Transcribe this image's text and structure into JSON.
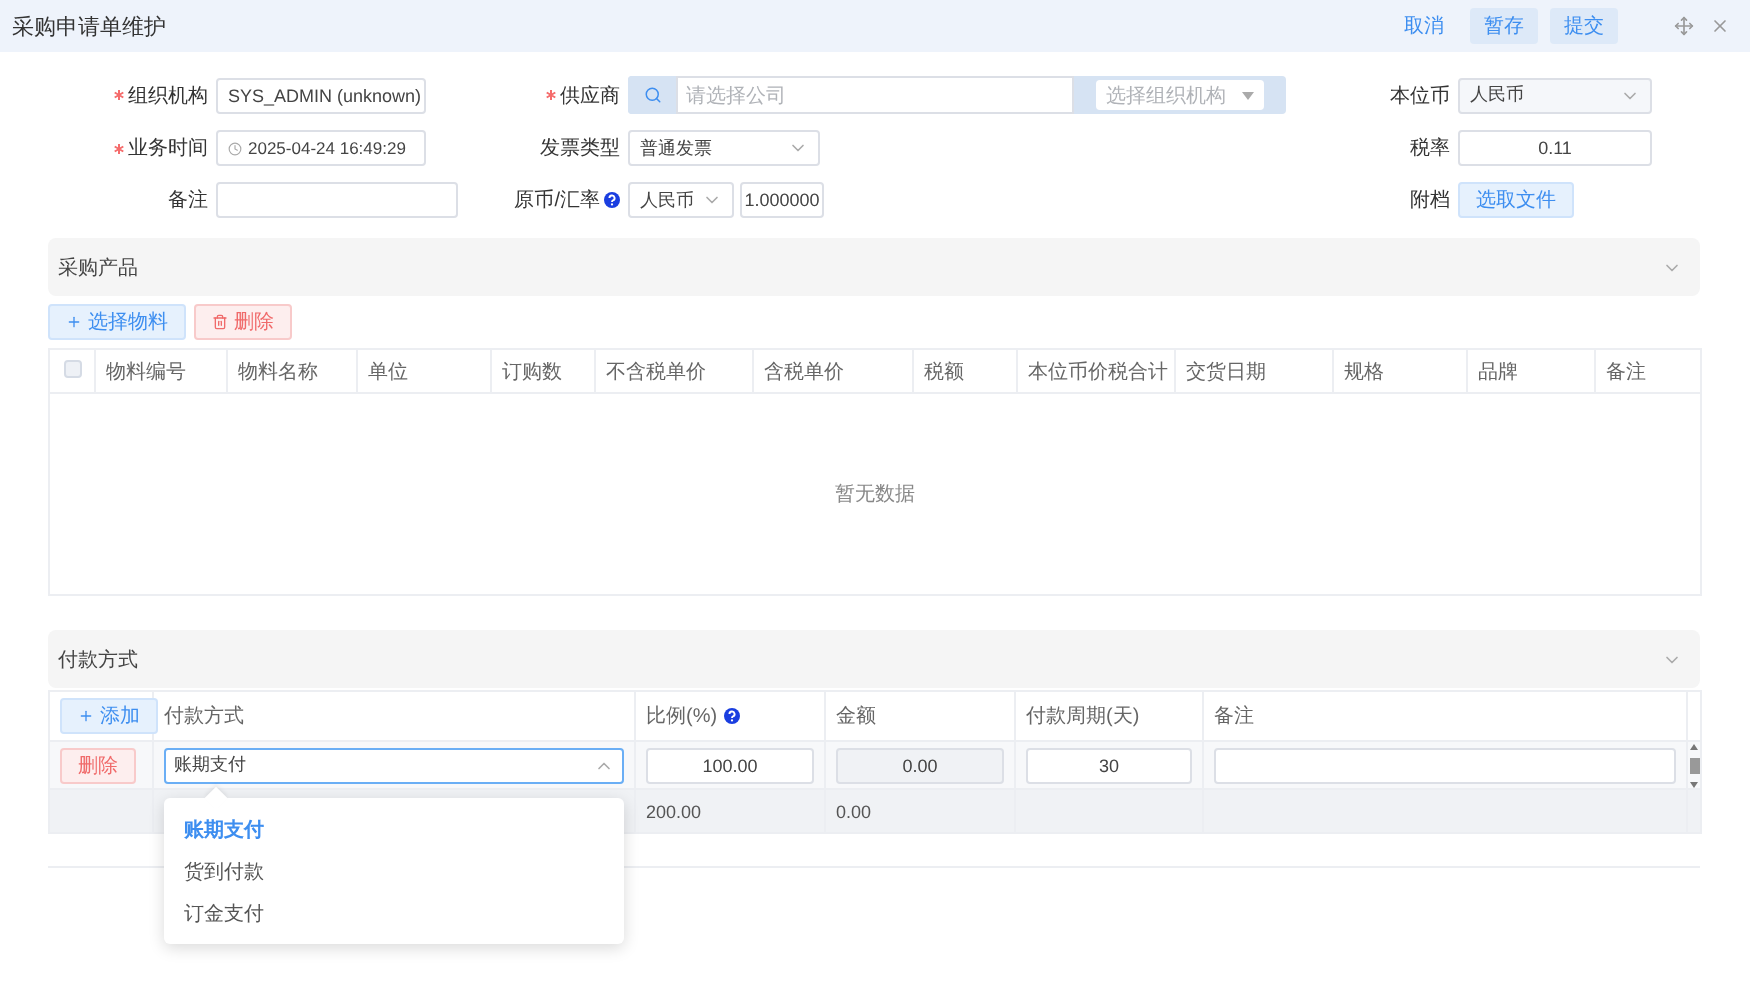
{
  "header": {
    "title": "采购申请单维护",
    "actions": [
      {
        "label": "取消",
        "kind": "link"
      },
      {
        "label": "暂存",
        "kind": "button"
      },
      {
        "label": "提交",
        "kind": "button"
      }
    ]
  },
  "form": {
    "fields": [
      {
        "label": "组织机构",
        "required": true,
        "kind": "select",
        "value": "SYS_ADMIN (unknown)"
      },
      {
        "label": "供应商",
        "required": true,
        "kind": "supplier",
        "placeholder": "请选择公司",
        "org_placeholder": "选择组织机构"
      },
      {
        "label": "本位币",
        "required": false,
        "kind": "select_light",
        "value": "人民币"
      },
      {
        "label": "业务时间",
        "required": true,
        "kind": "date",
        "value": "2025-04-24 16:49:29"
      },
      {
        "label": "发票类型",
        "required": false,
        "kind": "select_light",
        "value": "普通发票"
      },
      {
        "label": "税率",
        "required": false,
        "kind": "number",
        "value": "0.11"
      },
      {
        "label": "备注",
        "required": false,
        "kind": "text"
      },
      {
        "label": "原币/汇率",
        "required": false,
        "kind": "currency_rate",
        "help": true,
        "currency": "人民币",
        "rate": "1.000000"
      },
      {
        "label": "附档",
        "required": false,
        "kind": "upload",
        "button_label": "选取文件"
      }
    ]
  },
  "products": {
    "title": "采购产品",
    "expanded": true,
    "toolbar": [
      {
        "label": "选择物料",
        "kind": "add"
      },
      {
        "label": "删除",
        "kind": "delete"
      }
    ],
    "select_all_checked": false,
    "columns": [
      "物料编号",
      "物料名称",
      "单位",
      "订购数",
      "不含税单价",
      "含税单价",
      "税额",
      "本位币价税合计",
      "交货日期",
      "规格",
      "品牌",
      "备注"
    ],
    "empty_text": "暂无数据"
  },
  "payment": {
    "title": "付款方式",
    "expanded": true,
    "add_label": "添加",
    "columns": [
      {
        "label": "付款方式",
        "help": false
      },
      {
        "label": "比例(%)",
        "help": true
      },
      {
        "label": "金额",
        "help": false
      },
      {
        "label": "付款周期(天)",
        "help": false
      },
      {
        "label": "备注",
        "help": false
      }
    ],
    "rows": [
      {
        "delete_label": "删除",
        "method": "账期支付",
        "open": true,
        "ratio": "100.00",
        "amount": "0.00",
        "period": "30"
      }
    ],
    "summary": {
      "ratio": "200.00",
      "amount": "0.00"
    },
    "options": [
      {
        "label": "账期支付",
        "selected": true
      },
      {
        "label": "货到付款",
        "selected": false
      },
      {
        "label": "订金支付",
        "selected": false
      }
    ]
  }
}
